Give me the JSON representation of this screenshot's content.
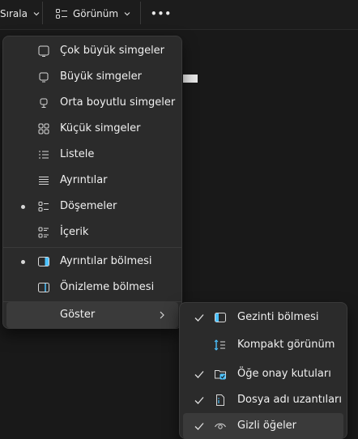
{
  "toolbar": {
    "sort_label": "Sırala",
    "view_label": "Görünüm",
    "more_label": "•••"
  },
  "view_menu": {
    "items": [
      {
        "label": "Çok büyük simgeler",
        "icon": "monitor-icon",
        "bullet": false
      },
      {
        "label": "Büyük simgeler",
        "icon": "monitor-icon",
        "bullet": false
      },
      {
        "label": "Orta boyutlu simgeler",
        "icon": "monitor-small-icon",
        "bullet": false
      },
      {
        "label": "Küçük simgeler",
        "icon": "grid-icon",
        "bullet": false
      },
      {
        "label": "Listele",
        "icon": "list-icon",
        "bullet": false
      },
      {
        "label": "Ayrıntılar",
        "icon": "details-icon",
        "bullet": false
      },
      {
        "label": "Döşemeler",
        "icon": "tiles-icon",
        "bullet": true
      },
      {
        "label": "İçerik",
        "icon": "content-icon",
        "bullet": false
      },
      {
        "label": "Ayrıntılar bölmesi",
        "icon": "details-pane-icon",
        "bullet": true
      },
      {
        "label": "Önizleme bölmesi",
        "icon": "preview-pane-icon",
        "bullet": false
      },
      {
        "label": "Göster",
        "icon": "",
        "bullet": false
      }
    ]
  },
  "show_submenu": {
    "items": [
      {
        "label": "Gezinti bölmesi",
        "icon": "navigation-pane-icon",
        "checked": true
      },
      {
        "label": "Kompakt görünüm",
        "icon": "compact-view-icon",
        "checked": false
      },
      {
        "label": "Öğe onay kutuları",
        "icon": "checkbox-icon",
        "checked": true
      },
      {
        "label": "Dosya adı uzantıları",
        "icon": "file-extension-icon",
        "checked": true
      },
      {
        "label": "Gizli öğeler",
        "icon": "eye-icon",
        "checked": true
      }
    ]
  },
  "colors": {
    "accent": "#4cc2ff",
    "menu_bg": "#2b2b2b",
    "highlight": "#3a3a3a"
  }
}
